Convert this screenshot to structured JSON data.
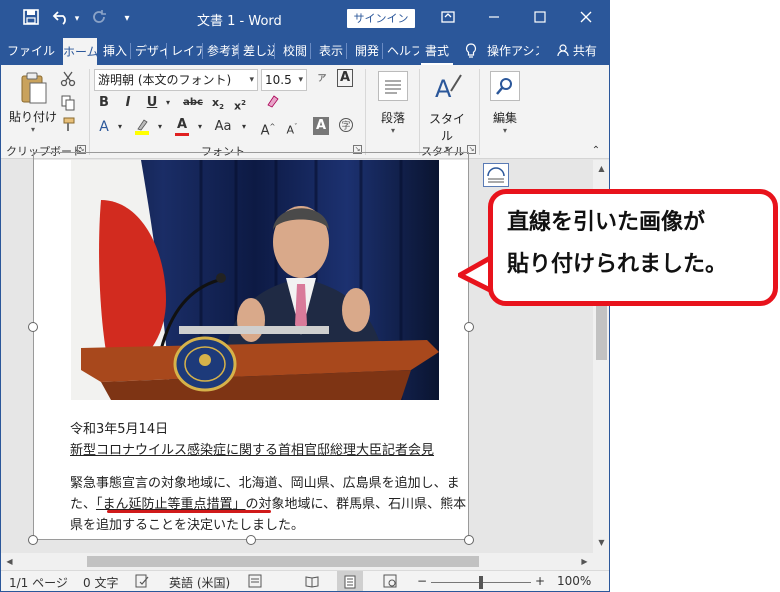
{
  "window": {
    "title": "文書 1  -  Word",
    "signin_label": "サインイン",
    "accent_color": "#2b579a"
  },
  "quick_access": {
    "save_icon": "save-icon",
    "undo_icon": "undo-icon",
    "redo_icon": "redo-icon",
    "customize_icon": "customize-qat-icon"
  },
  "tabs": [
    {
      "label": "ファイル"
    },
    {
      "label": "ホーム"
    },
    {
      "label": "挿入"
    },
    {
      "label": "デザイン"
    },
    {
      "label": "レイアウト"
    },
    {
      "label": "参考資料"
    },
    {
      "label": "差し込み"
    },
    {
      "label": "校閲"
    },
    {
      "label": "表示"
    },
    {
      "label": "開発"
    },
    {
      "label": "ヘルプ"
    },
    {
      "label": "書式"
    },
    {
      "label": "操作アシスト"
    },
    {
      "label": "共有"
    }
  ],
  "ribbon": {
    "paste_label": "貼り付け",
    "clipboard_label": "クリップボード",
    "font_name": "游明朝 (本文のフォント)",
    "font_size": "10.5",
    "font_group_label": "フォント",
    "paragraph_label": "段落",
    "style_label": "スタイル",
    "style_group_label": "スタイル",
    "edit_label": "編集"
  },
  "document": {
    "date_line": "令和3年5月14日",
    "caption": "新型コロナウイルス感染症に関する首相官邸総理大臣記者会見",
    "body_line1": "緊急事態宣言の対象地域に、北海道、岡山県、広島県を追加し、ま",
    "body_line2_pre": "た、",
    "body_line2_quote": "「まん延防止等重点措置」",
    "body_line2_post": "の対象地域に、群馬県、石川県、熊本",
    "body_line3": "県を追加することを決定いたしました。"
  },
  "status": {
    "page": "1/1 ページ",
    "words": "0 文字",
    "language": "英語 (米国)",
    "zoom": "100%",
    "zoom_minus": "−",
    "zoom_plus": "+",
    "zoom_level": 0.5
  },
  "callout": {
    "line1": "直線を引いた画像が",
    "line2": "貼り付けられました。",
    "border_color": "#e8131c"
  }
}
